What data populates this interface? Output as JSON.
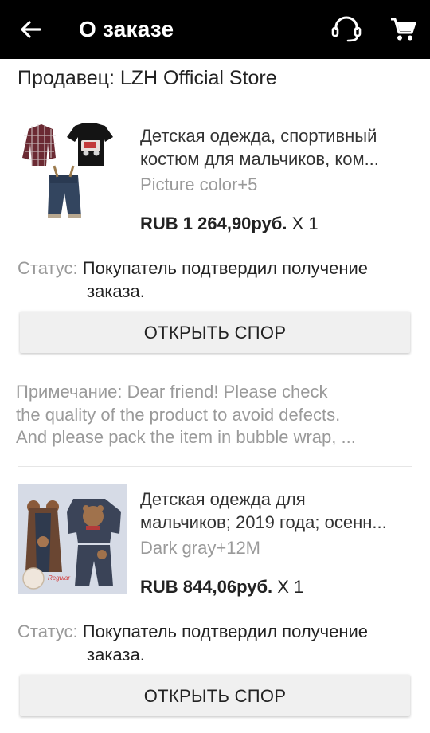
{
  "header": {
    "title": "О заказе",
    "back_icon": "arrow-left-icon",
    "support_icon": "headset-icon",
    "cart_icon": "cart-icon"
  },
  "seller": "Продавец: LZH Official Store",
  "items": [
    {
      "name_line1": "Детская одежда, спортивный",
      "name_line2": "костюм для мальчиков, ком...",
      "variant": "Picture color+5",
      "price": "RUB 1 264,90руб.",
      "qty": " X 1",
      "status_label": "Статус:",
      "status_line1": " Покупатель подтвердил получение",
      "status_line2": "заказа.",
      "dispute_label": "ОТКРЫТЬ СПОР",
      "note_label": "Примечание:",
      "note_line1": " Dear friend! Please check",
      "note_line2": "the quality of the product to avoid defects.",
      "note_line3": "And please pack the item in bubble wrap, ..."
    },
    {
      "name_line1": "Детская одежда для",
      "name_line2": "мальчиков; 2019 года; осенн...",
      "variant": "Dark gray+12M",
      "price": "RUB 844,06руб.",
      "qty": " X 1",
      "status_label": "Статус:",
      "status_line1": " Покупатель подтвердил получение",
      "status_line2": "заказа.",
      "dispute_label": "ОТКРЫТЬ СПОР",
      "image_badge": "Regular"
    }
  ]
}
